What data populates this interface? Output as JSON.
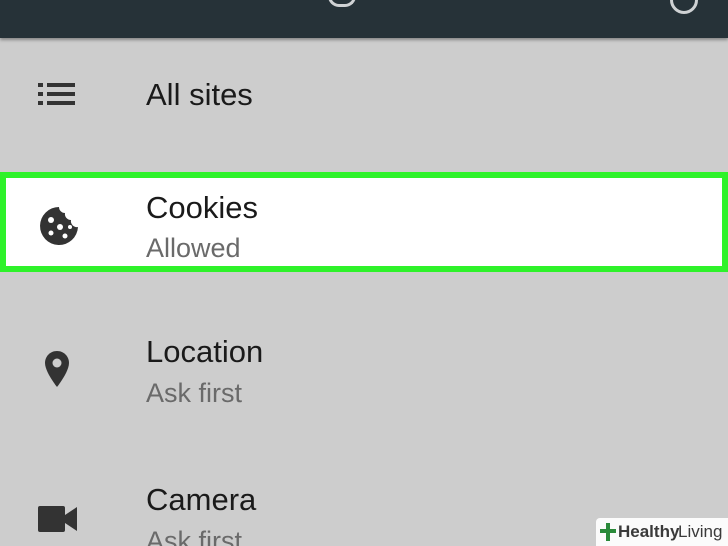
{
  "list": {
    "all_sites": {
      "title": "All sites",
      "icon": "list-icon"
    },
    "cookies": {
      "title": "Cookies",
      "subtitle": "Allowed",
      "icon": "cookie-icon",
      "highlight_color": "#2ef22a"
    },
    "location": {
      "title": "Location",
      "subtitle": "Ask first",
      "icon": "location-pin-icon"
    },
    "camera": {
      "title": "Camera",
      "subtitle": "Ask first",
      "icon": "videocam-icon"
    }
  },
  "watermark": {
    "part1": "Healthy",
    "part2": "Living"
  },
  "colors": {
    "topbar": "#263238",
    "background": "#cdcdcd",
    "highlight": "#2ef22a"
  }
}
